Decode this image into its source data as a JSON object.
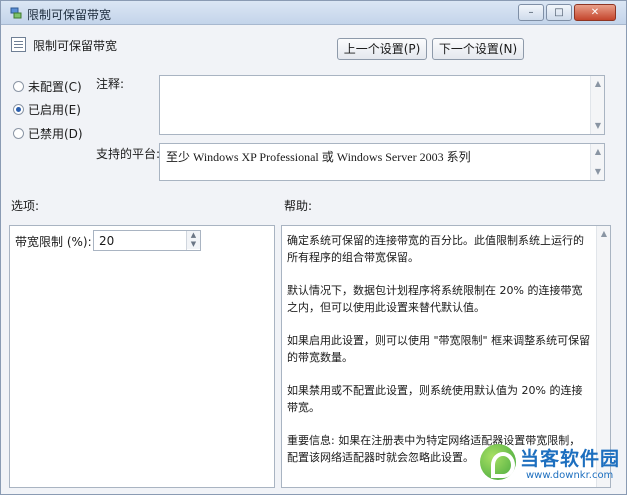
{
  "window": {
    "title": "限制可保留带宽",
    "controls": {
      "minimize": "–",
      "maximize": "□",
      "close": "✕"
    }
  },
  "header": {
    "title": "限制可保留带宽",
    "prev_button": "上一个设置(P)",
    "next_button": "下一个设置(N)"
  },
  "state_options": [
    {
      "label": "未配置(C)",
      "checked": false
    },
    {
      "label": "已启用(E)",
      "checked": true
    },
    {
      "label": "已禁用(D)",
      "checked": false
    }
  ],
  "comment": {
    "label": "注释:",
    "value": ""
  },
  "platform": {
    "label": "支持的平台:",
    "value": "至少 Windows XP Professional 或 Windows Server 2003 系列"
  },
  "options": {
    "label": "选项:",
    "bandwidth_label": "带宽限制 (%):",
    "bandwidth_value": "20"
  },
  "help": {
    "label": "帮助:",
    "paragraphs": [
      "确定系统可保留的连接带宽的百分比。此值限制系统上运行的所有程序的组合带宽保留。",
      "默认情况下，数据包计划程序将系统限制在 20% 的连接带宽之内，但可以使用此设置来替代默认值。",
      "如果启用此设置，则可以使用 \"带宽限制\" 框来调整系统可保留的带宽数量。",
      "如果禁用或不配置此设置，则系统使用默认值为 20% 的连接带宽。",
      "重要信息: 如果在注册表中为特定网络适配器设置带宽限制，配置该网络适配器时就会忽略此设置。"
    ]
  },
  "watermark": {
    "title": "当客软件园",
    "url": "www.downkr.com"
  },
  "icons": {
    "app": "network-bandwidth-icon",
    "header": "policy-setting-icon",
    "scroll_up": "scroll-up-arrow-icon",
    "scroll_down": "scroll-down-arrow-icon"
  }
}
